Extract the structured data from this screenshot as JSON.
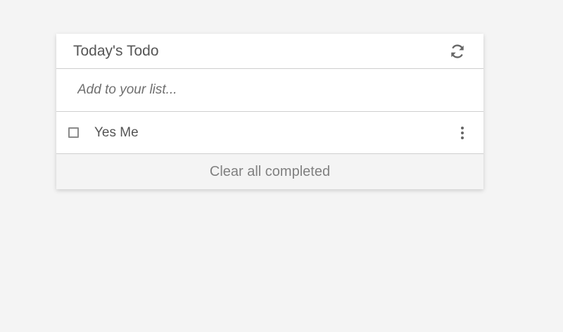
{
  "header": {
    "title": "Today's Todo",
    "refresh_icon": "refresh-icon"
  },
  "add": {
    "placeholder": "Add to your list..."
  },
  "todos": [
    {
      "label": "Yes Me",
      "checked": false
    }
  ],
  "footer": {
    "clear_label": "Clear all completed"
  },
  "colors": {
    "background": "#f4f4f4",
    "card": "#ffffff",
    "text": "#555555",
    "muted": "#808080",
    "divider": "#cfcfcf"
  }
}
